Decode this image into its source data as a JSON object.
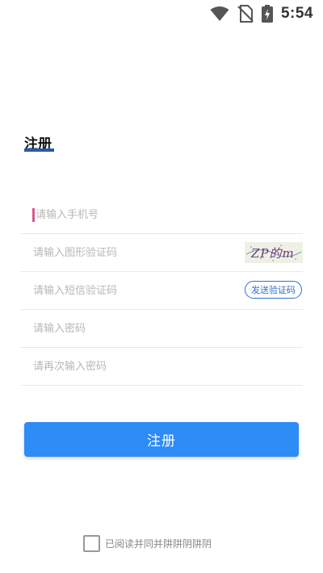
{
  "status_bar": {
    "time": "5:54",
    "icons": [
      "wifi-icon",
      "no-sim-icon",
      "battery-charging-icon"
    ]
  },
  "page": {
    "title": "注册"
  },
  "form": {
    "phone_placeholder": "请输入手机号",
    "captcha_placeholder": "请输入图形验证码",
    "captcha_text": "ZP的m",
    "sms_placeholder": "请输入短信验证码",
    "sms_button_label": "发送验证码",
    "password_placeholder": "请输入密码",
    "password_confirm_placeholder": "请再次输入密码"
  },
  "submit": {
    "label": "注册"
  },
  "agreement": {
    "text": "已阅读并同并阱阱阴阱阴",
    "checked": false
  },
  "colors": {
    "accent": "#2d8cf6",
    "link_blue": "#2f6fd6",
    "title_underline": "#2a5aa8",
    "cursor": "#e0528a"
  }
}
